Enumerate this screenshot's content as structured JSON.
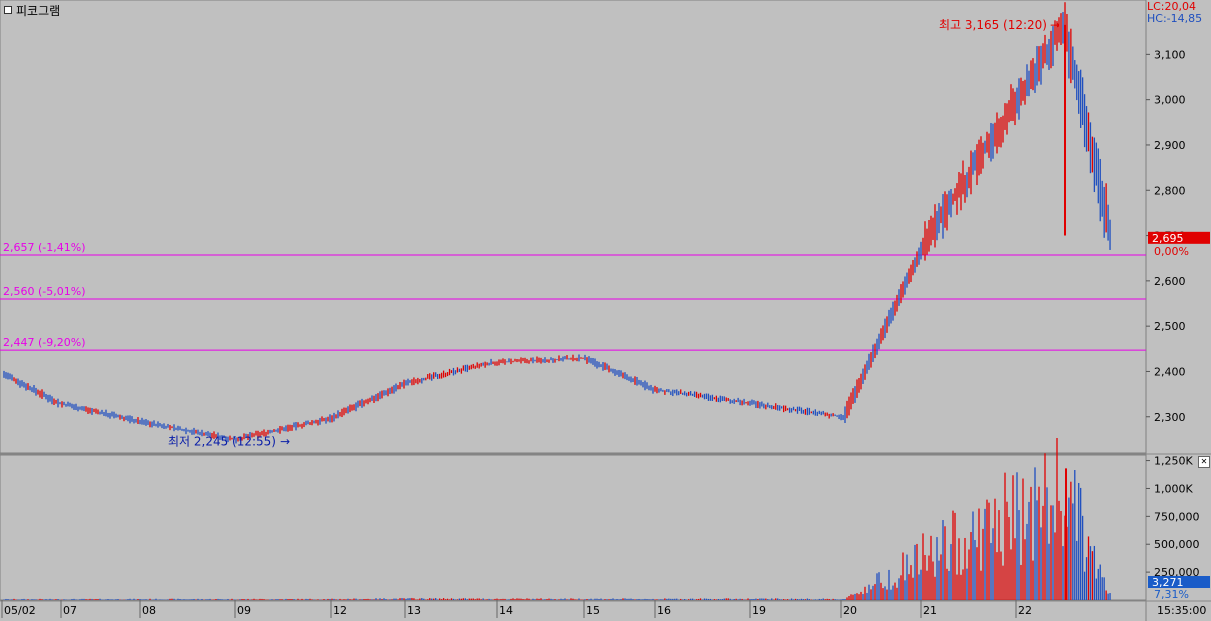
{
  "window": {
    "title": "피코그램"
  },
  "indicators": {
    "lc": "LC:20,04",
    "hc": "HC:-14,85"
  },
  "colors": {
    "bg": "#c0c0c0",
    "up": "#e00000",
    "down": "#1f4fbf",
    "support": "#e800e8",
    "axis": "#808080",
    "badge_price": "#e00000",
    "badge_vol": "#1a5cc8"
  },
  "price_axis": {
    "ticks": [
      "3,100",
      "3,000",
      "2,900",
      "2,800",
      "2,700",
      "2,600",
      "2,500",
      "2,400",
      "2,300"
    ],
    "tick_values": [
      3100,
      3000,
      2900,
      2800,
      2700,
      2600,
      2500,
      2400,
      2300
    ],
    "ylim": [
      2220,
      3220
    ]
  },
  "current_price": {
    "label": "2,695",
    "value": 2695,
    "change": "0,00%"
  },
  "support_lines": [
    {
      "label": "2,657 (-1,41%)",
      "value": 2657
    },
    {
      "label": "2,560 (-5,01%)",
      "value": 2560
    },
    {
      "label": "2,447 (-9,20%)",
      "value": 2447
    }
  ],
  "annotations": {
    "high": {
      "label": "최고 3,165 (12:20)",
      "value": 3165
    },
    "low": {
      "label": "최저 2,245 (12:55)",
      "value": 2245
    }
  },
  "volume_axis": {
    "ticks": [
      "1,250K",
      "1,000K",
      "750,000",
      "500,000",
      "250,000"
    ],
    "tick_values": [
      1250000,
      1000000,
      750000,
      500000,
      250000
    ],
    "ylim": [
      0,
      1300000
    ]
  },
  "current_volume": {
    "label": "3,271",
    "ratio": "7,31%"
  },
  "x_axis": {
    "dates": [
      "05/02",
      "07",
      "08",
      "09",
      "12",
      "13",
      "14",
      "15",
      "16",
      "19",
      "20",
      "21",
      "22"
    ],
    "time": "15:35:00"
  },
  "chart_data": {
    "type": "line",
    "title": "",
    "x": [
      "05/02",
      "07",
      "08",
      "09",
      "12",
      "13",
      "14",
      "15",
      "16",
      "19",
      "20",
      "21",
      "22"
    ],
    "series": [
      {
        "values": [
          2395,
          2330,
          2290,
          2250,
          2295,
          2375,
          2420,
          2430,
          2360,
          2330,
          2300,
          2680,
          3165,
          2695
        ]
      }
    ],
    "volume": [
      8000,
      8000,
      9000,
      9000,
      9000,
      15000,
      12000,
      12000,
      11000,
      12000,
      10000,
      480000,
      1180000,
      3271
    ],
    "ylim": [
      2220,
      3220
    ],
    "grid": false
  }
}
